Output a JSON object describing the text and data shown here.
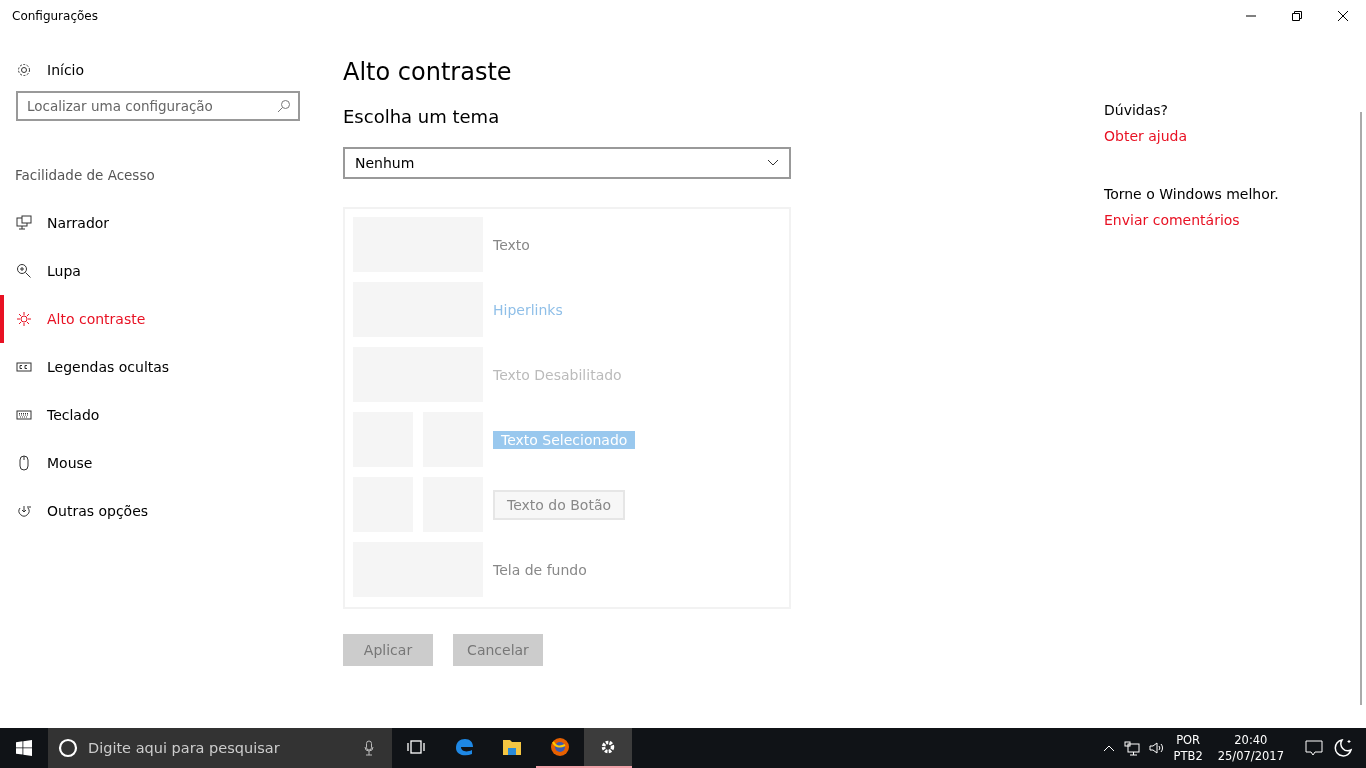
{
  "window": {
    "title": "Configurações"
  },
  "sidebar": {
    "home": "Início",
    "search": {
      "placeholder": "Localizar uma configuração"
    },
    "section": "Facilidade de Acesso",
    "items": [
      {
        "label": "Narrador",
        "selected": false
      },
      {
        "label": "Lupa",
        "selected": false
      },
      {
        "label": "Alto contraste",
        "selected": true
      },
      {
        "label": "Legendas ocultas",
        "selected": false
      },
      {
        "label": "Teclado",
        "selected": false
      },
      {
        "label": "Mouse",
        "selected": false
      },
      {
        "label": "Outras opções",
        "selected": false
      }
    ]
  },
  "main": {
    "title": "Alto contraste",
    "subtitle": "Escolha um tema",
    "theme_dropdown": {
      "value": "Nenhum"
    },
    "preview": [
      {
        "kind": "text",
        "label": "Texto"
      },
      {
        "kind": "link",
        "label": "Hiperlinks"
      },
      {
        "kind": "disabled",
        "label": "Texto Desabilitado"
      },
      {
        "kind": "selected",
        "label": "Texto Selecionado"
      },
      {
        "kind": "button",
        "label": "Texto do Botão"
      },
      {
        "kind": "background",
        "label": "Tela de fundo"
      }
    ],
    "buttons": [
      {
        "label": "Aplicar",
        "disabled": true
      },
      {
        "label": "Cancelar",
        "disabled": true
      }
    ]
  },
  "aside": [
    {
      "heading": "Dúvidas?",
      "link": "Obter ajuda"
    },
    {
      "heading": "Torne o Windows melhor.",
      "link": "Enviar comentários"
    }
  ],
  "taskbar": {
    "search": {
      "placeholder": "Digite aqui para pesquisar"
    },
    "apps": [
      {
        "running": false,
        "selected": false
      },
      {
        "running": false,
        "selected": false
      },
      {
        "running": false,
        "selected": false
      },
      {
        "running": true,
        "selected": false
      },
      {
        "running": true,
        "selected": true
      }
    ],
    "language": "POR",
    "layout": "PTB2",
    "time": "20:40",
    "date": "25/07/2017"
  }
}
